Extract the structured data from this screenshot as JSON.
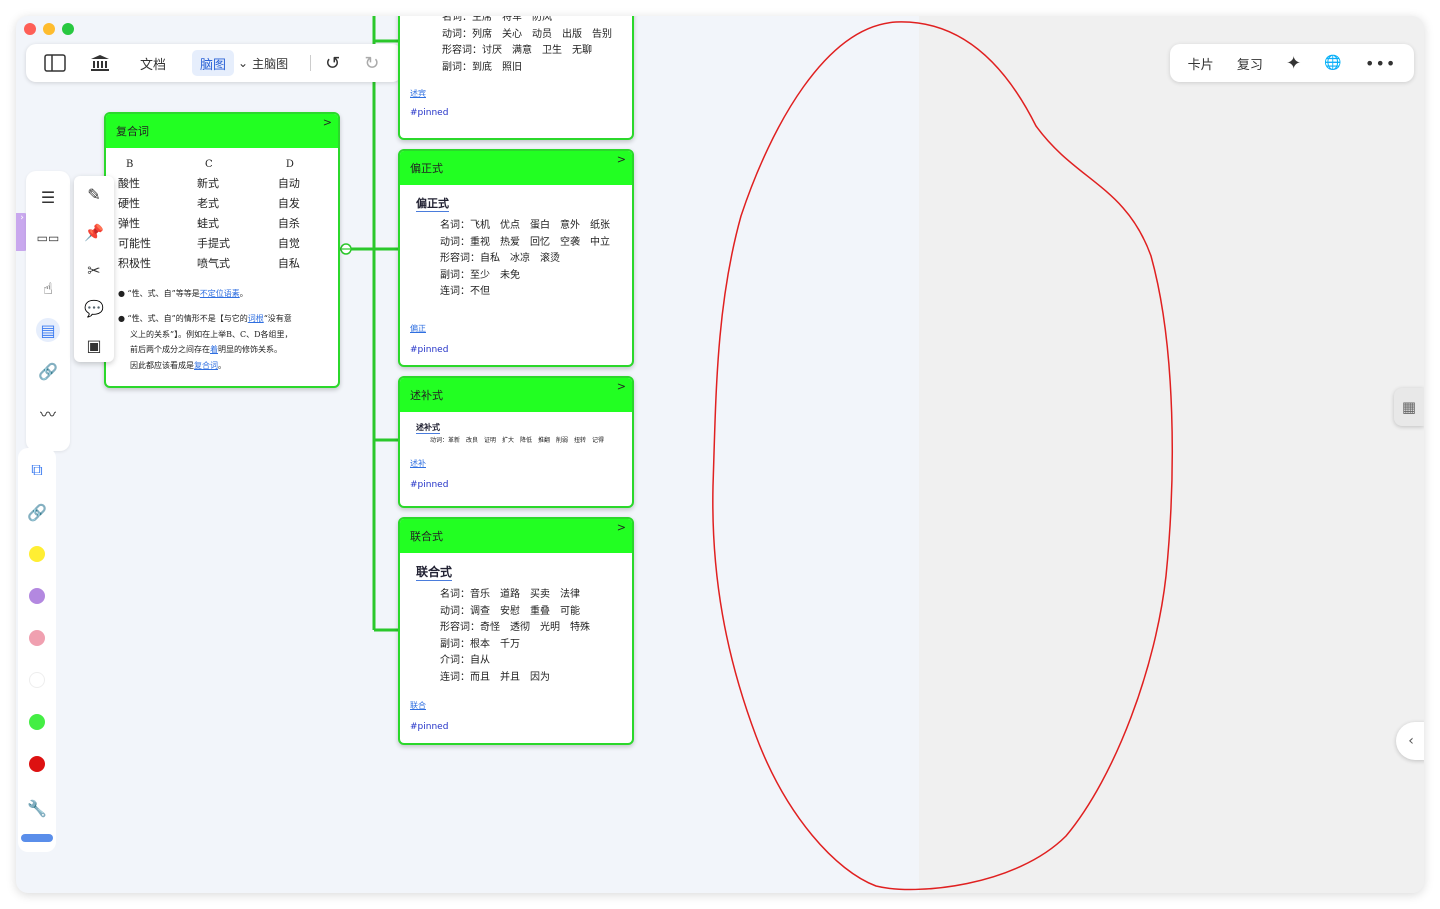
{
  "toolbar": {
    "doc_label": "文档",
    "mindmap_label": "脑图",
    "main_mindmap_label": "主脑图"
  },
  "right_toolbar": {
    "card_label": "卡片",
    "review_label": "复习"
  },
  "cards": {
    "top": {
      "lines": [
        "名词：主席　将军　防风",
        "动词：列席　关心　动员　出版　告别",
        "形容词：讨厌　满意　卫生　无聊",
        "副词：到底　照旧"
      ],
      "link": "述宾",
      "tag": "#pinned"
    },
    "compound": {
      "title": "复合词",
      "columns": [
        {
          "header": "B",
          "items": [
            "酸性",
            "硬性",
            "弹性",
            "可能性",
            "积极性"
          ]
        },
        {
          "header": "C",
          "items": [
            "新式",
            "老式",
            "蛙式",
            "手提式",
            "喷气式"
          ]
        },
        {
          "header": "D",
          "items": [
            "自动",
            "自发",
            "自杀",
            "自觉",
            "自私"
          ]
        }
      ],
      "note1_prefix": "“性、式、自”等等是",
      "note1_link": "不定位语素",
      "note1_suffix": "。",
      "note2_line1_prefix": "“性、式、自”的情形不是【与它的",
      "note2_line1_link": "词根",
      "note2_line1_suffix": "“没有意",
      "note2_line2": "义上的关系”】。例如在上举B、C、D各组里，",
      "note2_line3_prefix": "前后两个成分之间存在",
      "note2_line3_link": "着",
      "note2_line3_suffix": "明显的修饰关系。",
      "note2_line4_prefix": "因此都应该看成是",
      "note2_line4_link": "复合词",
      "note2_line4_suffix": "。"
    },
    "pianzheng": {
      "title": "偏正式",
      "subtitle": "偏正式",
      "lines": [
        "名词：飞机　优点　蛋白　意外　纸张",
        "动词：重视　热爱　回忆　空袭　中立",
        "形容词：自私　冰凉　滚烫",
        "副词：至少　未免",
        "连词：不但"
      ],
      "link": "偏正",
      "tag": "#pinned"
    },
    "shubu": {
      "title": "述补式",
      "subtitle": "述补式",
      "line": "动词：革新　改良　证明　扩大　降低　推翻　削弱　扭转　记得",
      "link": "述补",
      "tag": "#pinned"
    },
    "lianhe": {
      "title": "联合式",
      "subtitle": "联合式",
      "lines": [
        "名词：音乐　道路　买卖　法律",
        "动词：调查　安慰　重叠　可能",
        "形容词：奇怪　透彻　光明　特殊",
        "副词：根本　千万",
        "介词：自从",
        "连词：而且　并且　因为"
      ],
      "link": "联合",
      "tag": "#pinned"
    }
  },
  "colors": {
    "card_header": "#22ff22",
    "card_border": "#2bd82b",
    "link": "#2f6fe0",
    "drawing": "#e02020",
    "palette": [
      "#ffee33",
      "#b388e0",
      "#f0a0b0",
      "#ffffff",
      "#44ee44",
      "#dd1111"
    ]
  },
  "icons": [
    "sidebar-toggle-icon",
    "library-icon",
    "chevron-down-icon",
    "undo-icon",
    "redo-icon",
    "sparkle-icon",
    "translate-icon",
    "more-icon",
    "list-icon",
    "layout-icon",
    "pointer-icon",
    "document-icon",
    "link-icon",
    "pen-icon",
    "edit-icon",
    "pin-icon",
    "tools-icon",
    "comment-icon",
    "export-icon",
    "copy-icon",
    "wrench-icon",
    "grid-icon",
    "chevron-left-icon"
  ]
}
